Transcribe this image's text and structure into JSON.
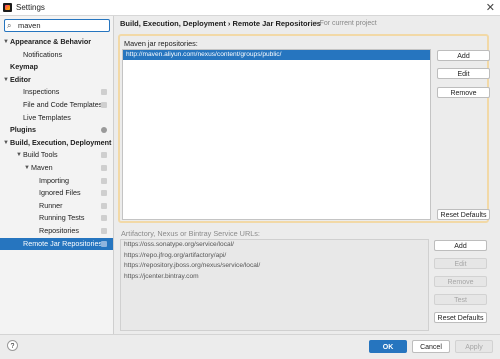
{
  "window": {
    "title": "Settings"
  },
  "search": {
    "value": "maven"
  },
  "tree": [
    {
      "label": "Appearance & Behavior",
      "level": 0,
      "expanded": true,
      "bold": true
    },
    {
      "label": "Notifications",
      "level": 1
    },
    {
      "label": "Keymap",
      "level": 0,
      "bold": true
    },
    {
      "label": "Editor",
      "level": 0,
      "expanded": true,
      "bold": true
    },
    {
      "label": "Inspections",
      "level": 1,
      "badge": "page"
    },
    {
      "label": "File and Code Templates",
      "level": 1,
      "badge": "page"
    },
    {
      "label": "Live Templates",
      "level": 1
    },
    {
      "label": "Plugins",
      "level": 0,
      "bold": true,
      "badge": "count"
    },
    {
      "label": "Build, Execution, Deployment",
      "level": 0,
      "expanded": true,
      "bold": true
    },
    {
      "label": "Build Tools",
      "level": 1,
      "expanded": true,
      "badge": "page"
    },
    {
      "label": "Maven",
      "level": 2,
      "expanded": true,
      "badge": "page"
    },
    {
      "label": "Importing",
      "level": 3,
      "badge": "page"
    },
    {
      "label": "Ignored Files",
      "level": 3,
      "badge": "page"
    },
    {
      "label": "Runner",
      "level": 3,
      "badge": "page"
    },
    {
      "label": "Running Tests",
      "level": 3,
      "badge": "page"
    },
    {
      "label": "Repositories",
      "level": 3,
      "badge": "page"
    },
    {
      "label": "Remote Jar Repositories",
      "level": 1,
      "selected": true,
      "badge": "page"
    }
  ],
  "header": {
    "breadcrumb": "Build, Execution, Deployment  ›  Remote Jar Repositories",
    "for_project": "For current project"
  },
  "maven": {
    "label": "Maven jar repositories:",
    "items": [
      "http://maven.aliyun.com/nexus/content/groups/public/"
    ],
    "buttons": {
      "add": "Add",
      "edit": "Edit",
      "remove": "Remove",
      "reset": "Reset Defaults"
    }
  },
  "artifactory": {
    "label": "Artifactory, Nexus or Bintray Service URLs:",
    "items": [
      "https://oss.sonatype.org/service/local/",
      "https://repo.jfrog.org/artifactory/api/",
      "https://repository.jboss.org/nexus/service/local/",
      "https://jcenter.bintray.com"
    ],
    "buttons": {
      "add": "Add",
      "edit": "Edit",
      "remove": "Remove",
      "test": "Test",
      "reset": "Reset Defaults"
    }
  },
  "footer": {
    "help": "?",
    "ok": "OK",
    "cancel": "Cancel",
    "apply": "Apply"
  },
  "colors": {
    "accent": "#2675bf",
    "highlight_border": "#f2d9a7"
  }
}
